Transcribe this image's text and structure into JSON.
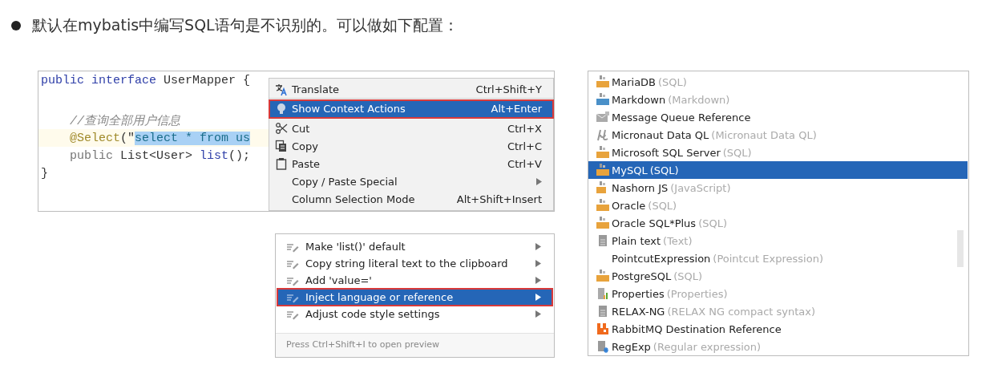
{
  "heading": {
    "text": "默认在mybatis中编写SQL语句是不识别的。可以做如下配置："
  },
  "editor": {
    "lines": [
      {
        "tokens": [
          {
            "text": "public interface ",
            "kind": "keyword"
          },
          {
            "text": "UserMapper {",
            "kind": "plain"
          }
        ]
      },
      {
        "tokens": [
          {
            "text": "    //查询全部用户信息",
            "kind": "comment"
          }
        ],
        "blank_line_before": true
      },
      {
        "tokens": [
          {
            "text": "    @Select",
            "kind": "annotation"
          },
          {
            "text": "(\"",
            "kind": "plain"
          },
          {
            "text": "select * from us",
            "kind": "selected"
          }
        ],
        "current": true
      },
      {
        "tokens": [
          {
            "text": "    public ",
            "kind": "keyword-gray"
          },
          {
            "text": "List<User> ",
            "kind": "plain"
          },
          {
            "text": "list",
            "kind": "method"
          },
          {
            "text": "();",
            "kind": "plain"
          }
        ]
      },
      {
        "tokens": [
          {
            "text": "}",
            "kind": "plain"
          }
        ]
      }
    ]
  },
  "context_menu": {
    "items": [
      {
        "kind": "translate",
        "label": "Translate",
        "shortcut": "Ctrl+Shift+Y",
        "selected": false,
        "outlined": false,
        "submenu": false,
        "separator_after": true
      },
      {
        "kind": "bulb",
        "label": "Show Context Actions",
        "shortcut": "Alt+Enter",
        "selected": true,
        "outlined": true,
        "submenu": false,
        "separator_after": true
      },
      {
        "kind": "scissors",
        "label": "Cut",
        "shortcut": "Ctrl+X",
        "selected": false,
        "outlined": false,
        "submenu": false,
        "separator_after": false
      },
      {
        "kind": "copy",
        "label": "Copy",
        "shortcut": "Ctrl+C",
        "selected": false,
        "outlined": false,
        "submenu": false,
        "separator_after": false
      },
      {
        "kind": "paste",
        "label": "Paste",
        "shortcut": "Ctrl+V",
        "selected": false,
        "outlined": false,
        "submenu": false,
        "separator_after": false
      },
      {
        "kind": "plain",
        "label": "Copy / Paste Special",
        "selected": false,
        "outlined": false,
        "submenu": true,
        "separator_after": false
      },
      {
        "kind": "plain",
        "label": "Column Selection Mode",
        "shortcut": "Alt+Shift+Insert",
        "selected": false,
        "outlined": false,
        "submenu": false,
        "separator_after": false
      }
    ]
  },
  "intention_popup": {
    "items": [
      {
        "label": "Make 'list()' default",
        "selected": false,
        "outlined": false
      },
      {
        "label": "Copy string literal text to the clipboard",
        "selected": false,
        "outlined": false
      },
      {
        "label": "Add 'value='",
        "selected": false,
        "outlined": false
      },
      {
        "label": "Inject language or reference",
        "selected": true,
        "outlined": true
      },
      {
        "label": "Adjust code style settings",
        "selected": false,
        "outlined": false
      }
    ],
    "hint": "Press Ctrl+Shift+I to open preview"
  },
  "language_list": {
    "items": [
      {
        "kind": "sql",
        "name": "MariaDB",
        "detail": "(SQL)",
        "selected": false
      },
      {
        "kind": "md",
        "name": "Markdown",
        "detail": "(Markdown)",
        "selected": false
      },
      {
        "kind": "envelope",
        "name": "Message Queue Reference",
        "selected": false
      },
      {
        "kind": "mu",
        "name": "Micronaut Data QL",
        "detail": "(Micronaut Data QL)",
        "selected": false
      },
      {
        "kind": "sql",
        "name": "Microsoft SQL Server",
        "detail": "(SQL)",
        "selected": false
      },
      {
        "kind": "sql",
        "name": "MySQL",
        "detail": "(SQL)",
        "selected": true
      },
      {
        "kind": "js",
        "name": "Nashorn JS",
        "detail": "(JavaScript)",
        "selected": false
      },
      {
        "kind": "sql",
        "name": "Oracle",
        "detail": "(SQL)",
        "selected": false
      },
      {
        "kind": "sql",
        "name": "Oracle SQL*Plus",
        "detail": "(SQL)",
        "selected": false
      },
      {
        "kind": "text",
        "name": "Plain text",
        "detail": "(Text)",
        "selected": false
      },
      {
        "kind": "plain",
        "name": "PointcutExpression",
        "detail": "(Pointcut Expression)",
        "selected": false
      },
      {
        "kind": "sql",
        "name": "PostgreSQL",
        "detail": "(SQL)",
        "selected": false
      },
      {
        "kind": "properties",
        "name": "Properties",
        "detail": "(Properties)",
        "selected": false
      },
      {
        "kind": "text",
        "name": "RELAX-NG",
        "detail": "(RELAX NG compact syntax)",
        "selected": false
      },
      {
        "kind": "rabbit",
        "name": "RabbitMQ Destination Reference",
        "selected": false
      },
      {
        "kind": "regexp",
        "name": "RegExp",
        "detail": "(Regular expression)",
        "selected": false
      }
    ]
  }
}
